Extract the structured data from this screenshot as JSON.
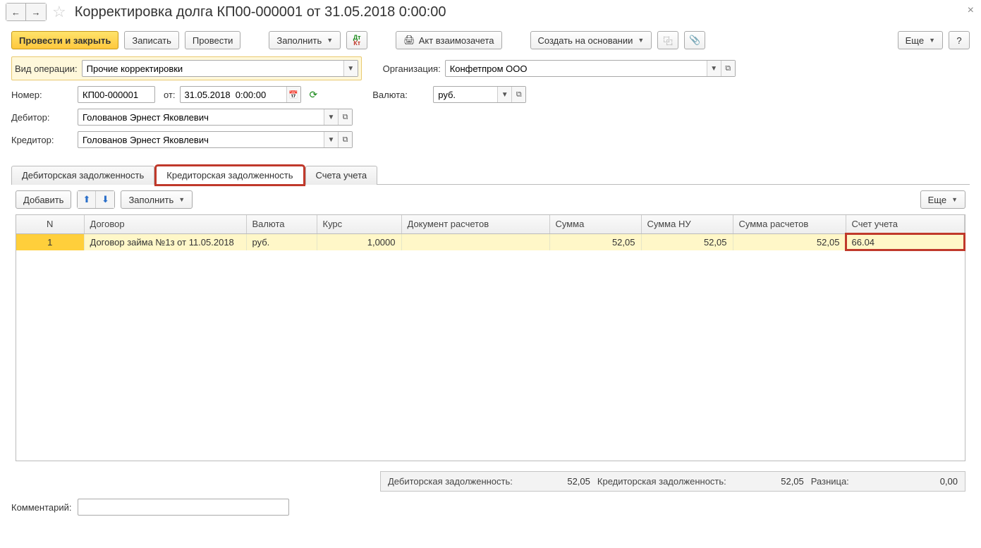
{
  "header": {
    "title": "Корректировка долга КП00-000001 от 31.05.2018 0:00:00"
  },
  "toolbar": {
    "post_close": "Провести и закрыть",
    "save": "Записать",
    "post": "Провести",
    "fill": "Заполнить",
    "offset_act": "Акт взаимозачета",
    "create_based": "Создать на основании",
    "more": "Еще",
    "help": "?"
  },
  "form": {
    "operation_label": "Вид операции:",
    "operation_value": "Прочие корректировки",
    "org_label": "Организация:",
    "org_value": "Конфетпром ООО",
    "number_label": "Номер:",
    "number_value": "КП00-000001",
    "date_label": "от:",
    "date_value": "31.05.2018  0:00:00",
    "currency_label": "Валюта:",
    "currency_value": "руб.",
    "debtor_label": "Дебитор:",
    "debtor_value": "Голованов Эрнест Яковлевич",
    "creditor_label": "Кредитор:",
    "creditor_value": "Голованов Эрнест Яковлевич"
  },
  "tabs": {
    "t1": "Дебиторская задолженность",
    "t2": "Кредиторская задолженность",
    "t3": "Счета учета"
  },
  "subtoolbar": {
    "add": "Добавить",
    "fill": "Заполнить",
    "more": "Еще"
  },
  "grid": {
    "headers": {
      "n": "N",
      "contract": "Договор",
      "currency": "Валюта",
      "rate": "Курс",
      "doc": "Документ расчетов",
      "sum": "Сумма",
      "sum_nu": "Сумма НУ",
      "sum_calc": "Сумма расчетов",
      "account": "Счет учета"
    },
    "rows": [
      {
        "n": "1",
        "contract": "Договор займа №1з от 11.05.2018",
        "currency": "руб.",
        "rate": "1,0000",
        "doc": "",
        "sum": "52,05",
        "sum_nu": "52,05",
        "sum_calc": "52,05",
        "account": "66.04"
      }
    ]
  },
  "summary": {
    "debit_label": "Дебиторская задолженность:",
    "debit_val": "52,05",
    "credit_label": "Кредиторская задолженность:",
    "credit_val": "52,05",
    "diff_label": "Разница:",
    "diff_val": "0,00"
  },
  "comment": {
    "label": "Комментарий:",
    "value": ""
  }
}
